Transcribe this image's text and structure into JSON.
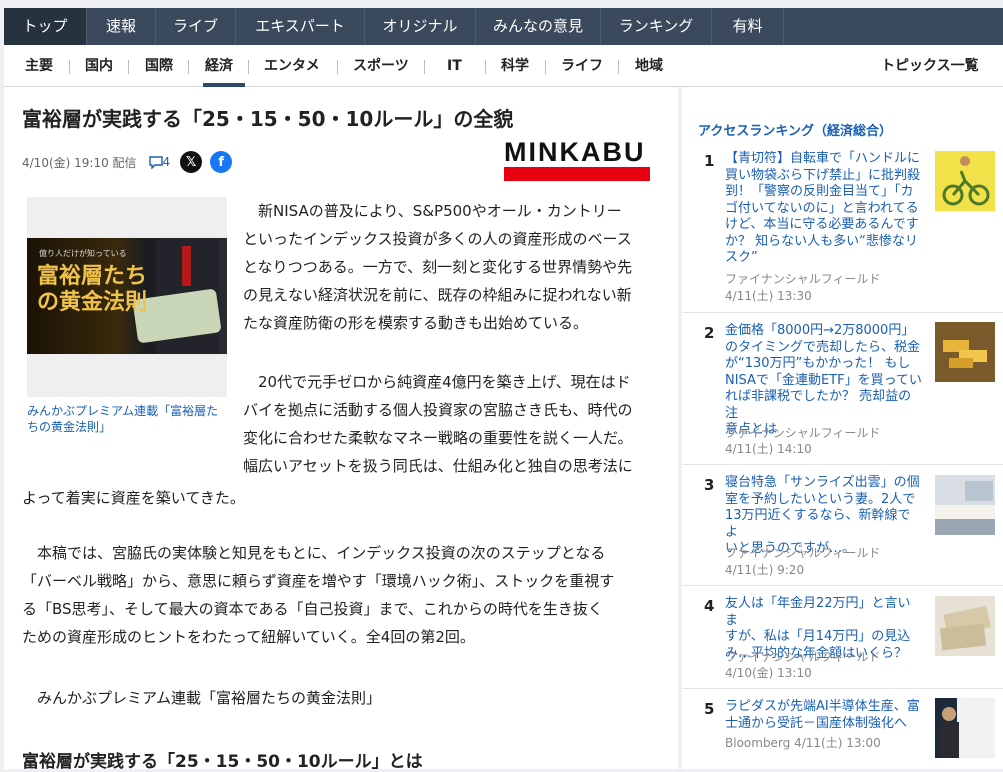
{
  "topnav": [
    "トップ",
    "速報",
    "ライブ",
    "エキスパート",
    "オリジナル",
    "みんなの意見",
    "ランキング",
    "有料"
  ],
  "subnav": [
    "主要",
    "国内",
    "国際",
    "経済",
    "エンタメ",
    "スポーツ",
    "IT",
    "科学",
    "ライフ",
    "地域"
  ],
  "subnav_right": "トピックス一覧",
  "article": {
    "title": "富裕層が実践する「25・15・50・10ルール」の全貌",
    "date": "4/10(金) 19:10 配信",
    "comments": "4",
    "logo": "MINKABU",
    "image_text": "富裕層たちの黄金法則",
    "image_subtext": "億り人だけが知っている",
    "caption": "みんかぶプレミアム連載「富裕層たちの黄金法則」",
    "p1": [
      "新NISAの普及により、S&P500やオール・カントリー",
      "といったインデックス投資が多くの人の資産形成のベース",
      "となりつつある。一方で、刻一刻と変化する世界情勢や先",
      "の見えない経済状況を前に、既存の枠組みに捉われない新",
      "たな資産防衛の形を模索する動きも出始めている。"
    ],
    "p2": [
      "20代で元手ゼロから純資産4億円を築き上げ、現在はド",
      "バイを拠点に活動する個人投資家の宮脇さき氏も、時代の",
      "変化に合わせた柔軟なマネー戦略の重要性を説く一人だ。",
      "幅広いアセットを扱う同氏は、仕組み化と独自の思考法に"
    ],
    "p2_tail": "よって着実に資産を築いてきた。",
    "p3": [
      "本稿では、宮脇氏の実体験と知見をもとに、インデックス投資の次のステップとなる",
      "「バーベル戦略」から、意思に頼らず資産を増やす「環境ハック術」、ストックを重視す",
      "る「BS思考」、そして最大の資本である「自己投資」まで、これからの時代を生き抜く",
      "ための資産形成のヒントをわたって紐解いていく。全4回の第2回。"
    ],
    "p4": "みんかぶプレミアム連載「富裕層たちの黄金法則」",
    "subheading": "富裕層が実践する「25・15・50・10ルール」とは"
  },
  "sidebar": {
    "heading": "アクセスランキング（経済総合）",
    "items": [
      {
        "rank": "1",
        "lines": [
          "【青切符】自転車で「ハンドルに",
          "買い物袋ぶら下げ禁止」に批判殺",
          "到！「警察の反則金目当て」「カ",
          "ゴ付いてないのに」と言われてる",
          "けど、本当に守る必要あるんです",
          "か？ 知らない人も多い“悲惨なリ",
          "スク”"
        ],
        "source": "ファイナンシャルフィールド",
        "date": "4/11(土) 13:30"
      },
      {
        "rank": "2",
        "lines": [
          "金価格「8000円→2万8000円」",
          "のタイミングで売却したら、税金",
          "が“130万円”もかかった！ もし",
          "NISAで「金連動ETF」を買ってい",
          "れば非課税でしたか？ 売却益の注",
          "意点とは"
        ],
        "source": "ファイナンシャルフィールド",
        "date": "4/11(土) 14:10"
      },
      {
        "rank": "3",
        "lines": [
          "寝台特急「サンライズ出雲」の個",
          "室を予約したいという妻。2人で",
          "13万円近くするなら、新幹線でよ",
          "いと思うのですが…。"
        ],
        "source": "ファイナンシャルフィールド",
        "date": "4/11(土) 9:20"
      },
      {
        "rank": "4",
        "lines": [
          "友人は「年金月22万円」と言いま",
          "すが、私は「月14万円」の見込",
          "み…平均的な年金額はいくら？"
        ],
        "source": "ファイナンシャルフィールド",
        "date": "4/10(金) 13:10"
      },
      {
        "rank": "5",
        "lines": [
          "ラピダスが先端AI半導体生産、富",
          "士通から受託－国産体制強化へ"
        ],
        "source": "Bloomberg",
        "date": "4/11(土) 13:00"
      }
    ]
  },
  "colors": {
    "nav_bg": "#3a4a5c",
    "link": "#1a5fb4",
    "brand_red": "#e60012"
  }
}
